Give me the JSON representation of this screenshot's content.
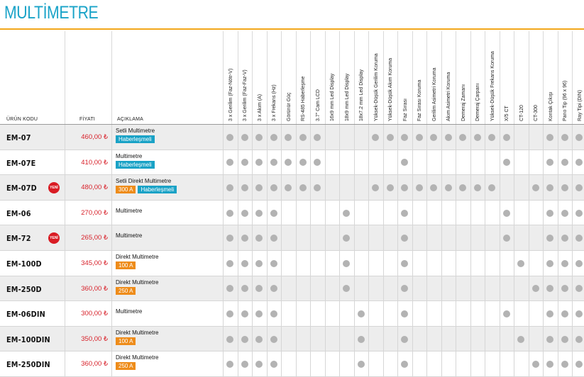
{
  "title": "MULTİMETRE",
  "headers": {
    "code": "ÜRÜN KODU",
    "price": "FİYATI",
    "desc": "AÇIKLAMA"
  },
  "features": [
    "3 x Gerilim (Faz-Nötr-V)",
    "3 x Gerilim (Faz-Faz-V)",
    "3 x Akım (A)",
    "3 x Frekans (Hz)",
    "Görünür Güç",
    "RS-485 Haberleşme",
    "3.7\" Cam LCD",
    "16x9 mm Led Display",
    "18x9 mm Led Display",
    "18x7.2 mm Led Display",
    "Yüksek-Düşük Gerilim Koruma",
    "Yüksek-Düşük Akım Koruma",
    "Faz Sırası",
    "Faz Sırası Koruma",
    "Gerilim Asimetri Koruma",
    "Akım Asimetri Koruma",
    "Demeraj Zamanı",
    "Demeraj Çarpanı",
    "Yüksek-Düşük Frekans Koruma",
    "X/5 CT",
    "CT-120",
    "CT-300",
    "Kontak Çıkışı",
    "Pano Tip (96 x 96)",
    "Ray Tipi (DIN)"
  ],
  "badge_new": "YENİ",
  "products": [
    {
      "code": "EM-07",
      "price": "460,00 ₺",
      "new": false,
      "desc": "Setli Multimetre",
      "tags": [
        {
          "text": "Haberleşmeli",
          "color": "blue"
        }
      ],
      "features": [
        0,
        1,
        2,
        3,
        4,
        5,
        6,
        10,
        11,
        12,
        13,
        14,
        15,
        16,
        17,
        18,
        19,
        22,
        23,
        24
      ]
    },
    {
      "code": "EM-07E",
      "price": "410,00 ₺",
      "new": false,
      "desc": "Multimetre",
      "tags": [
        {
          "text": "Haberleşmeli",
          "color": "blue"
        }
      ],
      "features": [
        0,
        1,
        2,
        3,
        4,
        5,
        6,
        12,
        19,
        22,
        23,
        24
      ]
    },
    {
      "code": "EM-07D",
      "price": "480,00 ₺",
      "new": true,
      "desc": "Setli Direkt Multimetre",
      "tags": [
        {
          "text": "300 A",
          "color": "orange"
        },
        {
          "text": "Haberleşmeli",
          "color": "blue"
        }
      ],
      "features": [
        0,
        1,
        2,
        3,
        4,
        5,
        6,
        10,
        11,
        12,
        13,
        14,
        15,
        16,
        17,
        18,
        21,
        22,
        23,
        24
      ]
    },
    {
      "code": "EM-06",
      "price": "270,00 ₺",
      "new": false,
      "desc": "Multimetre",
      "tags": [],
      "features": [
        0,
        1,
        2,
        3,
        8,
        12,
        19,
        22,
        23,
        24
      ]
    },
    {
      "code": "EM-72",
      "price": "265,00 ₺",
      "new": true,
      "desc": "Multimetre",
      "tags": [],
      "features": [
        0,
        1,
        2,
        3,
        8,
        12,
        19,
        22,
        23,
        24
      ]
    },
    {
      "code": "EM-100D",
      "price": "345,00 ₺",
      "new": false,
      "desc": "Direkt Multimetre",
      "tags": [
        {
          "text": "100 A",
          "color": "orange"
        }
      ],
      "features": [
        0,
        1,
        2,
        3,
        8,
        12,
        20,
        22,
        23,
        24
      ]
    },
    {
      "code": "EM-250D",
      "price": "360,00 ₺",
      "new": false,
      "desc": "Direkt Multimetre",
      "tags": [
        {
          "text": "250 A",
          "color": "orange"
        }
      ],
      "features": [
        0,
        1,
        2,
        3,
        8,
        12,
        21,
        22,
        23,
        24
      ]
    },
    {
      "code": "EM-06DIN",
      "price": "300,00 ₺",
      "new": false,
      "desc": "Multimetre",
      "tags": [],
      "features": [
        0,
        1,
        2,
        3,
        9,
        12,
        19,
        22,
        23,
        24
      ]
    },
    {
      "code": "EM-100DIN",
      "price": "350,00 ₺",
      "new": false,
      "desc": "Direkt Multimetre",
      "tags": [
        {
          "text": "100 A",
          "color": "orange"
        }
      ],
      "features": [
        0,
        1,
        2,
        3,
        9,
        12,
        20,
        22,
        23,
        24
      ]
    },
    {
      "code": "EM-250DIN",
      "price": "360,00 ₺",
      "new": false,
      "desc": "Direkt Multimetre",
      "tags": [
        {
          "text": "250 A",
          "color": "orange"
        }
      ],
      "features": [
        0,
        1,
        2,
        3,
        9,
        12,
        21,
        22,
        23,
        24
      ]
    }
  ]
}
